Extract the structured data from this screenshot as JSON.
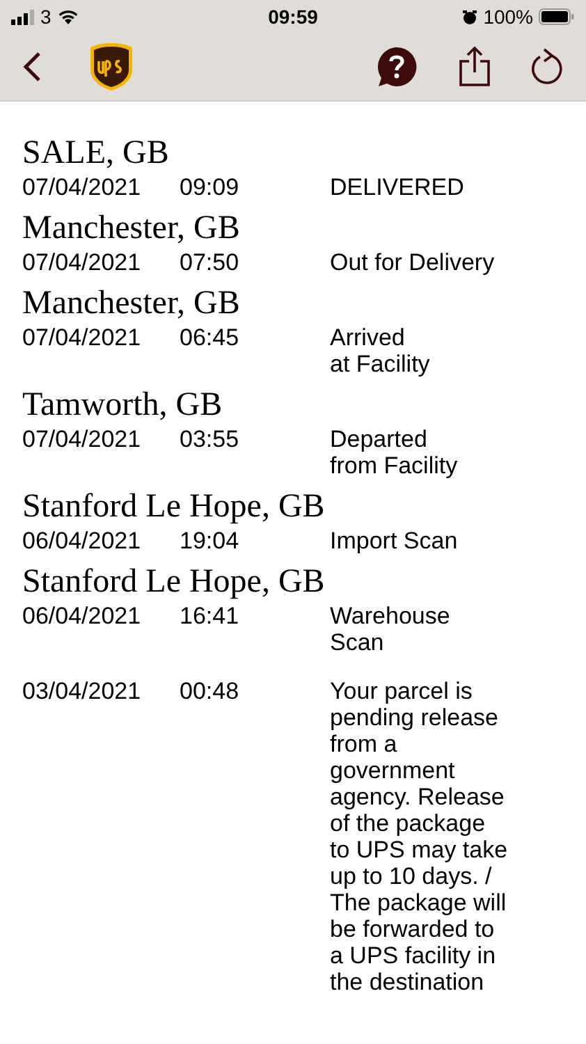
{
  "status_bar": {
    "carrier": "3",
    "time": "09:59",
    "battery": "100%"
  },
  "events": [
    {
      "location": "SALE, GB",
      "date": "07/04/2021",
      "time": "09:09",
      "status": "DELIVERED"
    },
    {
      "location": "Manchester, GB",
      "date": "07/04/2021",
      "time": "07:50",
      "status": "Out for Delivery"
    },
    {
      "location": "Manchester, GB",
      "date": "07/04/2021",
      "time": "06:45",
      "status": "Arrived\nat Facility"
    },
    {
      "location": "Tamworth, GB",
      "date": "07/04/2021",
      "time": "03:55",
      "status": "Departed\nfrom Facility"
    },
    {
      "location": "Stanford Le Hope, GB",
      "date": "06/04/2021",
      "time": "19:04",
      "status": "Import Scan"
    },
    {
      "location": "Stanford Le Hope, GB",
      "date": "06/04/2021",
      "time": "16:41",
      "status": "Warehouse\nScan"
    },
    {
      "date": "03/04/2021",
      "time": "00:48",
      "status": "Your parcel is pending release from a government agency. Release of the package to UPS may take up to 10 days. / The package will be forwarded to a UPS facility in the destination"
    }
  ]
}
